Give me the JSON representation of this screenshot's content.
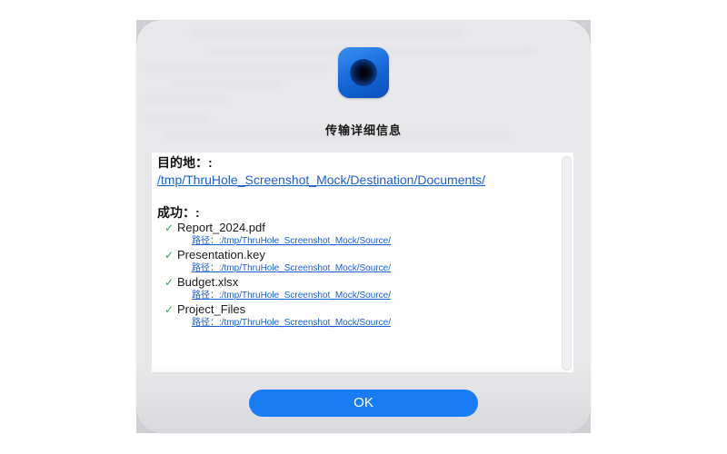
{
  "dialog": {
    "title": "传输详细信息",
    "destination_label": "目的地：:",
    "destination_path": "/tmp/ThruHole_Screenshot_Mock/Destination/Documents/",
    "success_label": "成功：:",
    "files": [
      {
        "check": "✓",
        "name": "Report_2024.pdf",
        "path": "路径：:/tmp/ThruHole_Screenshot_Mock/Source/"
      },
      {
        "check": "✓",
        "name": "Presentation.key",
        "path": "路径：:/tmp/ThruHole_Screenshot_Mock/Source/"
      },
      {
        "check": "✓",
        "name": "Budget.xlsx",
        "path": "路径：:/tmp/ThruHole_Screenshot_Mock/Source/"
      },
      {
        "check": "✓",
        "name": "Project_Files",
        "path": "路径：:/tmp/ThruHole_Screenshot_Mock/Source/"
      }
    ],
    "ok_label": "OK",
    "app_icon": "thruhole-app-icon"
  },
  "colors": {
    "accent": "#1a7cf2",
    "link": "#1a5fd0",
    "check": "#2fa84f"
  }
}
